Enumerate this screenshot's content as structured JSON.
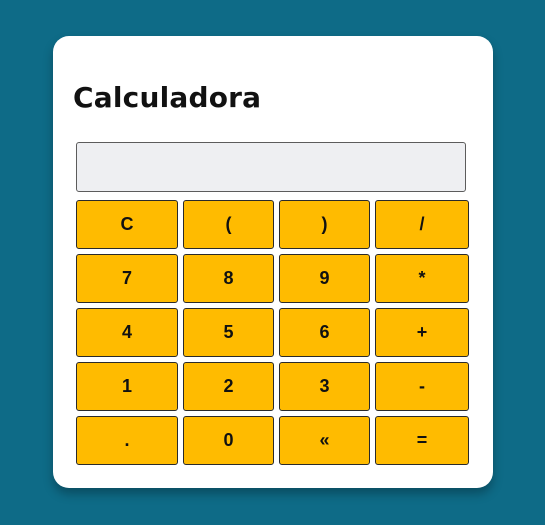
{
  "app": {
    "title": "Calculadora"
  },
  "display": {
    "value": ""
  },
  "keys": [
    [
      "C",
      "(",
      ")",
      "/"
    ],
    [
      "7",
      "8",
      "9",
      "*"
    ],
    [
      "4",
      "5",
      "6",
      "+"
    ],
    [
      "1",
      "2",
      "3",
      "-"
    ],
    [
      ".",
      "0",
      "«",
      "="
    ]
  ],
  "colors": {
    "background": "#0e6b87",
    "card": "#ffffff",
    "key": "#ffbb00",
    "display": "#eeeff2"
  }
}
